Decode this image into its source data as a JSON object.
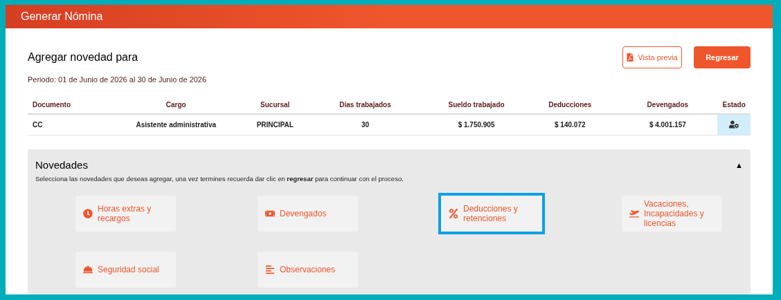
{
  "window": {
    "title": "Generar Nómina"
  },
  "heading": "Agregar novedad para",
  "period": "Periodo: 01 de Junio de 2026 al 30 de Junio de 2026",
  "buttons": [
    {
      "label": "Vista previa",
      "kind": "outline"
    },
    {
      "label": "Regresar",
      "kind": "solid"
    }
  ],
  "table": {
    "columns": [
      "Documento",
      "Cargo",
      "Sucursal",
      "Dias trabajados",
      "Sueldo trabajado",
      "Deducciones",
      "Devengados",
      "Estado"
    ],
    "rows": [
      [
        "CC",
        "Asistente administrativa",
        "PRINCIPAL",
        "30",
        "$ 1.750.905",
        "$ 140.072",
        "$ 4.001.157"
      ]
    ]
  },
  "novedades": {
    "title": "Novedades",
    "expanded": true,
    "toggle": "▲",
    "description": "Selecciona las novedades que deseas agregar, una vez termines recuerda dar clic en **regresar** para continuar con el proceso.",
    "items": [
      {
        "label": "Horas extras y recargos",
        "kind": "clock",
        "selected": false
      },
      {
        "label": "Devengados",
        "kind": "money",
        "selected": false
      },
      {
        "label": "Deducciones y retenciones",
        "kind": "percent",
        "selected": true
      },
      {
        "label": "Vacaciones, Incapacidades y licencias",
        "kind": "plane",
        "selected": false
      },
      {
        "label": "Seguridad social",
        "kind": "hardhat",
        "selected": false
      },
      {
        "label": "Observaciones",
        "kind": "lines",
        "selected": false
      }
    ]
  }
}
